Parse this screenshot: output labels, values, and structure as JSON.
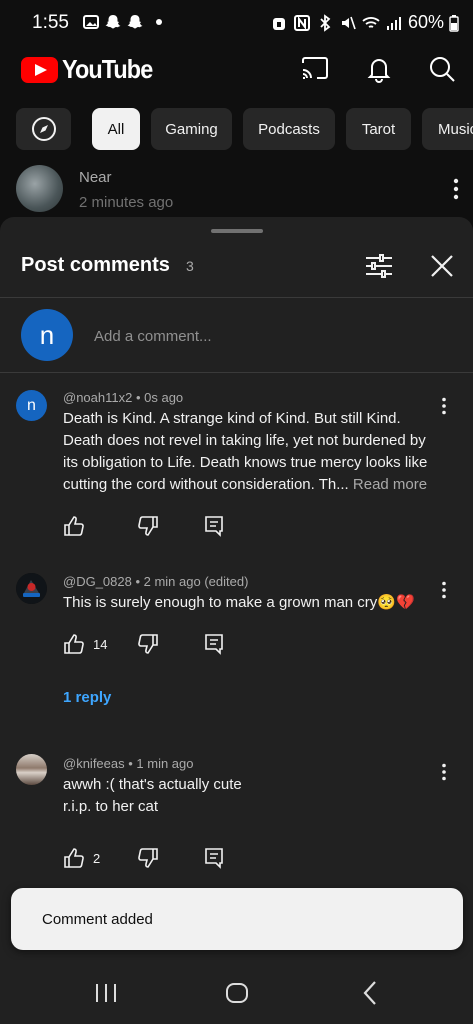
{
  "status_bar": {
    "time": "1:55",
    "battery": "60%"
  },
  "header": {
    "logo_text": "YouTube",
    "brand_color": "#ff0000"
  },
  "chips": [
    "All",
    "Gaming",
    "Podcasts",
    "Tarot",
    "Music"
  ],
  "background_post": {
    "author": "Near",
    "time": "2 minutes ago"
  },
  "sheet": {
    "title": "Post comments",
    "count": "3",
    "add_comment_placeholder": "Add a comment...",
    "current_user_initial": "n"
  },
  "comments": [
    {
      "meta": "@noah11x2 • 0s ago",
      "avatar_initial": "n",
      "avatar_color": "#1565c0",
      "text": "Death is Kind. A strange kind of Kind. But still Kind. Death does not revel in taking life, yet not burdened by its obligation to Life. Death knows true mercy looks like cutting the cord without consideration. Th...",
      "read_more": "Read more",
      "likes": ""
    },
    {
      "meta": "@DG_0828 • 2 min ago (edited)",
      "text": "This is surely enough to make a grown man cry🥺💔",
      "likes": "14",
      "reply_label": "1 reply"
    },
    {
      "meta": "@knifeeas • 1 min ago",
      "text_line1": "awwh :( that's actually cute",
      "text_line2": "r.i.p. to her cat",
      "likes": "2"
    }
  ],
  "toast": {
    "text": "Comment added"
  },
  "colors": {
    "background": "#0f0f0f",
    "sheet": "#212121",
    "link": "#3ea6ff",
    "avatar_blue": "#1565c0"
  }
}
